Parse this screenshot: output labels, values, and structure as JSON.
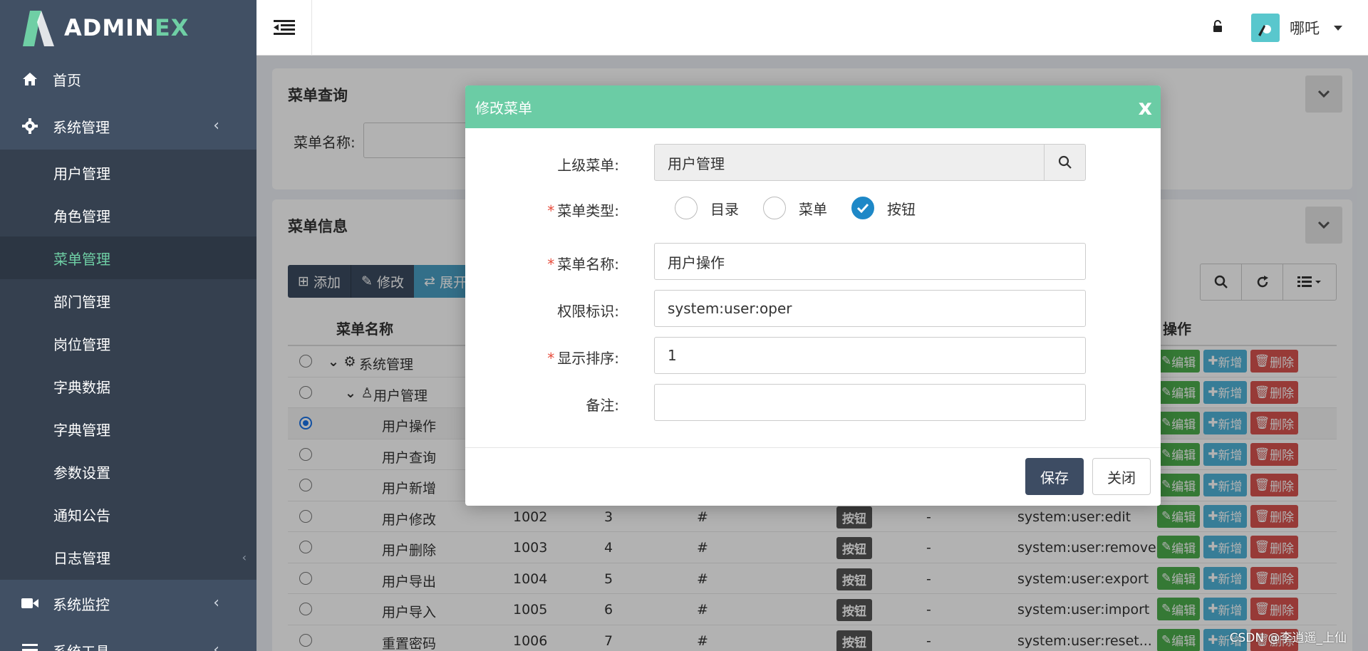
{
  "app": {
    "logo_text_main": "ADMIN",
    "logo_text_accent": "EX"
  },
  "sidebar": {
    "home": "首页",
    "system_mgmt": "系统管理",
    "sub_items": [
      "用户管理",
      "角色管理",
      "菜单管理",
      "部门管理",
      "岗位管理",
      "字典数据",
      "字典管理",
      "参数设置",
      "通知公告",
      "日志管理"
    ],
    "monitor": "系统监控",
    "tools": "系统工具"
  },
  "header": {
    "username": "哪吒"
  },
  "query_panel": {
    "title": "菜单查询",
    "label": "菜单名称:"
  },
  "info_panel": {
    "title": "菜单信息",
    "toolbar": {
      "add": "添加",
      "edit": "修改",
      "expand": "展开"
    },
    "columns": {
      "name": "菜单名称",
      "ops": "操作"
    },
    "op_labels": {
      "edit": "编辑",
      "add": "新增",
      "delete": "删除"
    },
    "badge_label": "按钮",
    "rows": [
      {
        "name": "系统管理",
        "id": "",
        "order": "",
        "url": "",
        "visible": "",
        "perm": ""
      },
      {
        "name": "用户管理",
        "id": "",
        "order": "",
        "url": "",
        "visible": "",
        "perm": ""
      },
      {
        "name": "用户操作",
        "id": "",
        "order": "",
        "url": "",
        "visible": "",
        "perm": ""
      },
      {
        "name": "用户查询",
        "id": "",
        "order": "",
        "url": "",
        "visible": "",
        "perm": ""
      },
      {
        "name": "用户新增",
        "id": "",
        "order": "",
        "url": "",
        "visible": "",
        "perm": ""
      },
      {
        "name": "用户修改",
        "id": "1002",
        "order": "3",
        "url": "#",
        "visible": "-",
        "perm": "system:user:edit"
      },
      {
        "name": "用户删除",
        "id": "1003",
        "order": "4",
        "url": "#",
        "visible": "-",
        "perm": "system:user:remove"
      },
      {
        "name": "用户导出",
        "id": "1004",
        "order": "5",
        "url": "#",
        "visible": "-",
        "perm": "system:user:export"
      },
      {
        "name": "用户导入",
        "id": "1005",
        "order": "6",
        "url": "#",
        "visible": "-",
        "perm": "system:user:import"
      },
      {
        "name": "重置密码",
        "id": "1006",
        "order": "7",
        "url": "#",
        "visible": "-",
        "perm": "system:user:reset..."
      }
    ]
  },
  "modal": {
    "title": "修改菜单",
    "close_symbol": "x",
    "parent_label": "上级菜单:",
    "parent_value": "用户管理",
    "type_label": "菜单类型:",
    "type_options": [
      "目录",
      "菜单",
      "按钮"
    ],
    "type_selected": "按钮",
    "name_label": "菜单名称:",
    "name_value": "用户操作",
    "perm_label": "权限标识:",
    "perm_value": "system:user:oper",
    "order_label": "显示排序:",
    "order_value": "1",
    "remark_label": "备注:",
    "remark_value": "",
    "required_mark": "*",
    "save": "保存",
    "close": "关闭"
  },
  "watermark": "CSDN @李逍遥_上仙",
  "colors": {
    "sidebar": "#415064",
    "accent": "#6fcfa5",
    "modal_header": "#6bcca5",
    "save_btn": "#3d4c63"
  }
}
